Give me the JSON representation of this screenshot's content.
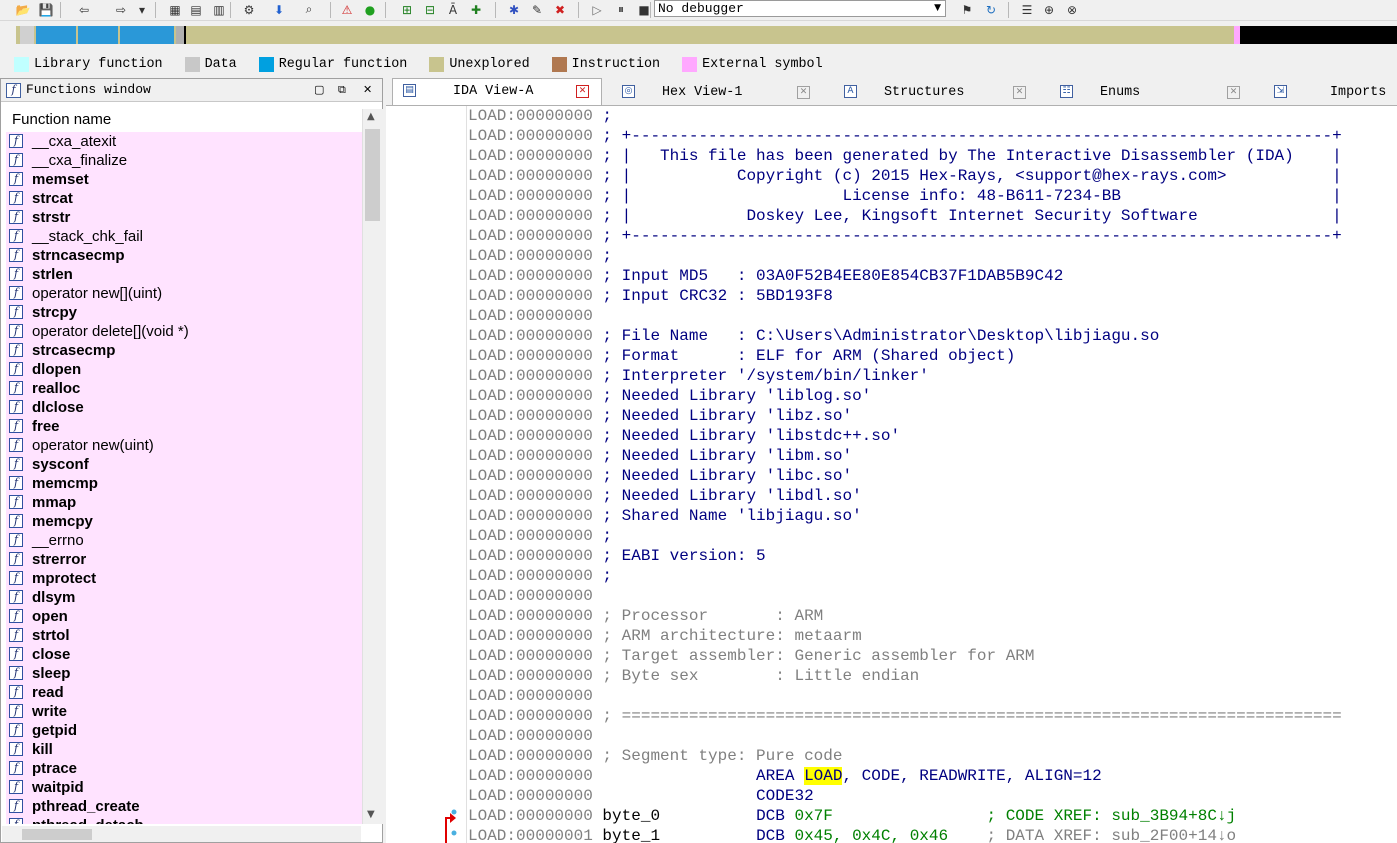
{
  "toolbar": {
    "icons": [
      "open-icon",
      "save-icon",
      "back-icon",
      "forward-icon",
      "dropdown-icon",
      "hex-icon",
      "hex-edit-icon",
      "text-icon",
      "patch-icon",
      "arrow-down-icon",
      "search-icon",
      "warning-icon",
      "green-dot-icon",
      "add-icon",
      "add2-icon",
      "add-letter-icon",
      "add-plus-icon",
      "star-icon",
      "edit-icon",
      "delete-icon",
      "play-icon",
      "pause-icon",
      "stop-icon",
      "debug-icon",
      "debug2-icon",
      "list-icon",
      "attach-icon",
      "detach-icon"
    ],
    "debugger_label": "No debugger"
  },
  "legend": [
    {
      "label": "Library function",
      "color": "#c0ffff"
    },
    {
      "label": "Data",
      "color": "#c8c8c8"
    },
    {
      "label": "Regular function",
      "color": "#00a0e0"
    },
    {
      "label": "Unexplored",
      "color": "#c8c48e"
    },
    {
      "label": "Instruction",
      "color": "#b07850"
    },
    {
      "label": "External symbol",
      "color": "#ffa8ff"
    }
  ],
  "functions_window": {
    "title": "Functions window",
    "column_header": "Function name",
    "items": [
      {
        "name": "__cxa_atexit",
        "bold": false
      },
      {
        "name": "__cxa_finalize",
        "bold": false
      },
      {
        "name": "memset",
        "bold": true
      },
      {
        "name": "strcat",
        "bold": true
      },
      {
        "name": "strstr",
        "bold": true
      },
      {
        "name": "__stack_chk_fail",
        "bold": false
      },
      {
        "name": "strncasecmp",
        "bold": true
      },
      {
        "name": "strlen",
        "bold": true
      },
      {
        "name": "operator new[](uint)",
        "bold": false
      },
      {
        "name": "strcpy",
        "bold": true
      },
      {
        "name": "operator delete[](void *)",
        "bold": false
      },
      {
        "name": "strcasecmp",
        "bold": true
      },
      {
        "name": "dlopen",
        "bold": true
      },
      {
        "name": "realloc",
        "bold": true
      },
      {
        "name": "dlclose",
        "bold": true
      },
      {
        "name": "free",
        "bold": true
      },
      {
        "name": "operator new(uint)",
        "bold": false
      },
      {
        "name": "sysconf",
        "bold": true
      },
      {
        "name": "memcmp",
        "bold": true
      },
      {
        "name": "mmap",
        "bold": true
      },
      {
        "name": "memcpy",
        "bold": true
      },
      {
        "name": "__errno",
        "bold": false
      },
      {
        "name": "strerror",
        "bold": true
      },
      {
        "name": "mprotect",
        "bold": true
      },
      {
        "name": "dlsym",
        "bold": true
      },
      {
        "name": "open",
        "bold": true
      },
      {
        "name": "strtol",
        "bold": true
      },
      {
        "name": "close",
        "bold": true
      },
      {
        "name": "sleep",
        "bold": true
      },
      {
        "name": "read",
        "bold": true
      },
      {
        "name": "write",
        "bold": true
      },
      {
        "name": "getpid",
        "bold": true
      },
      {
        "name": "kill",
        "bold": true
      },
      {
        "name": "ptrace",
        "bold": true
      },
      {
        "name": "waitpid",
        "bold": true
      },
      {
        "name": "pthread_create",
        "bold": true
      },
      {
        "name": "pthread_detach",
        "bold": true
      }
    ]
  },
  "tabs": [
    {
      "label": "IDA View-A",
      "active": true,
      "icon": "ida-view-icon"
    },
    {
      "label": "Hex View-1",
      "active": false,
      "icon": "hex-view-icon"
    },
    {
      "label": "Structures",
      "active": false,
      "icon": "structures-icon"
    },
    {
      "label": "Enums",
      "active": false,
      "icon": "enums-icon"
    },
    {
      "label": "Imports",
      "active": false,
      "icon": "imports-icon"
    }
  ],
  "disassembly": [
    {
      "addr": "LOAD:00000000",
      "parts": [
        {
          "t": " ;",
          "c": "c-blue"
        }
      ]
    },
    {
      "addr": "LOAD:00000000",
      "parts": [
        {
          "t": " ; +-------------------------------------------------------------------------+",
          "c": "c-blue"
        }
      ]
    },
    {
      "addr": "LOAD:00000000",
      "parts": [
        {
          "t": " ; |   This file has been generated by The Interactive Disassembler (IDA)    |",
          "c": "c-blue"
        }
      ]
    },
    {
      "addr": "LOAD:00000000",
      "parts": [
        {
          "t": " ; |           Copyright (c) 2015 Hex-Rays, <support@hex-rays.com>           |",
          "c": "c-blue"
        }
      ]
    },
    {
      "addr": "LOAD:00000000",
      "parts": [
        {
          "t": " ; |                      License info: 48-B611-7234-BB                      |",
          "c": "c-blue"
        }
      ]
    },
    {
      "addr": "LOAD:00000000",
      "parts": [
        {
          "t": " ; |            Doskey Lee, Kingsoft Internet Security Software              |",
          "c": "c-blue"
        }
      ]
    },
    {
      "addr": "LOAD:00000000",
      "parts": [
        {
          "t": " ; +-------------------------------------------------------------------------+",
          "c": "c-blue"
        }
      ]
    },
    {
      "addr": "LOAD:00000000",
      "parts": [
        {
          "t": " ;",
          "c": "c-blue"
        }
      ]
    },
    {
      "addr": "LOAD:00000000",
      "parts": [
        {
          "t": " ; Input MD5   : 03A0F52B4EE80E854CB37F1DAB5B9C42",
          "c": "c-blue"
        }
      ]
    },
    {
      "addr": "LOAD:00000000",
      "parts": [
        {
          "t": " ; Input CRC32 : 5BD193F8",
          "c": "c-blue"
        }
      ]
    },
    {
      "addr": "LOAD:00000000",
      "parts": [
        {
          "t": "",
          "c": "c-blue"
        }
      ]
    },
    {
      "addr": "LOAD:00000000",
      "parts": [
        {
          "t": " ; File Name   : C:\\Users\\Administrator\\Desktop\\libjiagu.so",
          "c": "c-blue"
        }
      ]
    },
    {
      "addr": "LOAD:00000000",
      "parts": [
        {
          "t": " ; Format      : ELF for ARM (Shared object)",
          "c": "c-blue"
        }
      ]
    },
    {
      "addr": "LOAD:00000000",
      "parts": [
        {
          "t": " ; Interpreter '/system/bin/linker'",
          "c": "c-blue"
        }
      ]
    },
    {
      "addr": "LOAD:00000000",
      "parts": [
        {
          "t": " ; Needed Library 'liblog.so'",
          "c": "c-blue"
        }
      ]
    },
    {
      "addr": "LOAD:00000000",
      "parts": [
        {
          "t": " ; Needed Library 'libz.so'",
          "c": "c-blue"
        }
      ]
    },
    {
      "addr": "LOAD:00000000",
      "parts": [
        {
          "t": " ; Needed Library 'libstdc++.so'",
          "c": "c-blue"
        }
      ]
    },
    {
      "addr": "LOAD:00000000",
      "parts": [
        {
          "t": " ; Needed Library 'libm.so'",
          "c": "c-blue"
        }
      ]
    },
    {
      "addr": "LOAD:00000000",
      "parts": [
        {
          "t": " ; Needed Library 'libc.so'",
          "c": "c-blue"
        }
      ]
    },
    {
      "addr": "LOAD:00000000",
      "parts": [
        {
          "t": " ; Needed Library 'libdl.so'",
          "c": "c-blue"
        }
      ]
    },
    {
      "addr": "LOAD:00000000",
      "parts": [
        {
          "t": " ; Shared Name 'libjiagu.so'",
          "c": "c-blue"
        }
      ]
    },
    {
      "addr": "LOAD:00000000",
      "parts": [
        {
          "t": " ;",
          "c": "c-blue"
        }
      ]
    },
    {
      "addr": "LOAD:00000000",
      "parts": [
        {
          "t": " ; EABI version: 5",
          "c": "c-blue"
        }
      ]
    },
    {
      "addr": "LOAD:00000000",
      "parts": [
        {
          "t": " ;",
          "c": "c-blue"
        }
      ]
    },
    {
      "addr": "LOAD:00000000",
      "parts": [
        {
          "t": "",
          "c": "c-blue"
        }
      ]
    },
    {
      "addr": "LOAD:00000000",
      "parts": [
        {
          "t": " ; Processor       : ARM",
          "c": "c-gray"
        }
      ]
    },
    {
      "addr": "LOAD:00000000",
      "parts": [
        {
          "t": " ; ARM architecture: metaarm",
          "c": "c-gray"
        }
      ]
    },
    {
      "addr": "LOAD:00000000",
      "parts": [
        {
          "t": " ; Target assembler: Generic assembler for ARM",
          "c": "c-gray"
        }
      ]
    },
    {
      "addr": "LOAD:00000000",
      "parts": [
        {
          "t": " ; Byte sex        : Little endian",
          "c": "c-gray"
        }
      ]
    },
    {
      "addr": "LOAD:00000000",
      "parts": [
        {
          "t": "",
          "c": "c-blue"
        }
      ]
    },
    {
      "addr": "LOAD:00000000",
      "parts": [
        {
          "t": " ; ===========================================================================",
          "c": "c-gray"
        }
      ]
    },
    {
      "addr": "LOAD:00000000",
      "parts": [
        {
          "t": "",
          "c": "c-blue"
        }
      ]
    },
    {
      "addr": "LOAD:00000000",
      "parts": [
        {
          "t": " ; Segment type: Pure code",
          "c": "c-gray"
        }
      ]
    },
    {
      "addr": "LOAD:00000000",
      "parts": [
        {
          "t": "                 AREA ",
          "c": "c-blue"
        },
        {
          "t": "LOAD",
          "c": "c-blue hl"
        },
        {
          "t": ", CODE, READWRITE, ALIGN=12",
          "c": "c-blue"
        }
      ]
    },
    {
      "addr": "LOAD:00000000",
      "parts": [
        {
          "t": "                 CODE32",
          "c": "c-blue"
        }
      ]
    },
    {
      "addr": "LOAD:00000000",
      "parts": [
        {
          "t": " byte_0          ",
          "c": "c-black"
        },
        {
          "t": "DCB ",
          "c": "c-blue"
        },
        {
          "t": "0x7F",
          "c": "c-green"
        },
        {
          "t": "                ; CODE XREF: sub_3B94+8C↓j",
          "c": "c-green"
        }
      ]
    },
    {
      "addr": "LOAD:00000001",
      "parts": [
        {
          "t": " byte_1          ",
          "c": "c-black"
        },
        {
          "t": "DCB ",
          "c": "c-blue"
        },
        {
          "t": "0x45, 0x4C, 0x46",
          "c": "c-green"
        },
        {
          "t": "    ; DATA XREF: sub_2F00+14↓o",
          "c": "c-gray"
        }
      ]
    }
  ]
}
